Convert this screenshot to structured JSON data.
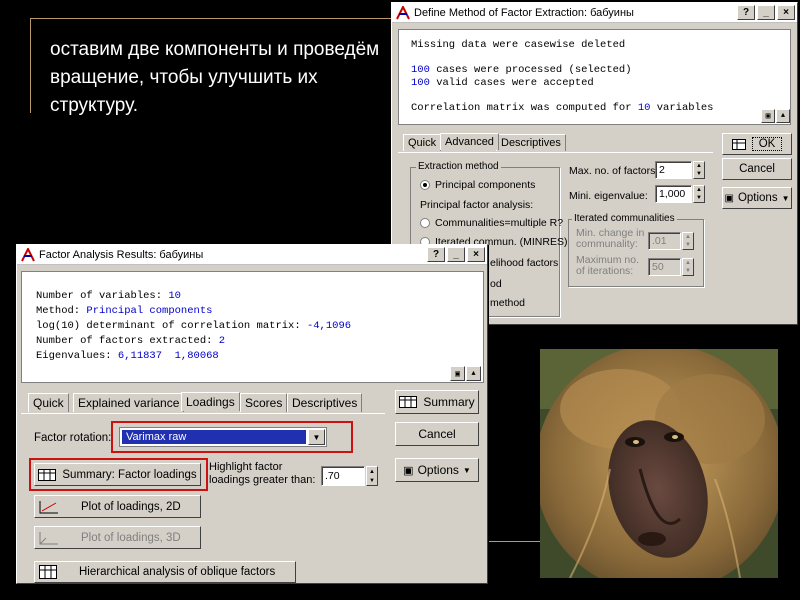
{
  "slide": {
    "text": "оставим две компоненты и проведём вращение, чтобы улучшить их структуру."
  },
  "define_window": {
    "title": "Define Method of Factor Extraction: бабуины",
    "output": {
      "missing": "Missing data were casewise deleted",
      "cases_processed_n": "100",
      "cases_processed_text": " cases were processed (selected)",
      "valid_cases_n": "100",
      "valid_cases_text": " valid cases were accepted",
      "corr_text": "Correlation matrix was computed for ",
      "corr_n": "10",
      "corr_unit": " variables"
    },
    "tabs": [
      "Quick",
      "Advanced",
      "Descriptives"
    ],
    "extraction_method_title": "Extraction method",
    "principal_components": "Principal components",
    "principal_factor_analysis": "Principal factor analysis:",
    "communalities_r": "Communalities=multiple R?",
    "iterated_communalities_option": "Iterated commun. (MINRES)",
    "likelihood_tail": "elihood factors",
    "method_tail_1": "od",
    "method_tail_2": "method",
    "max_factors_label": "Max. no. of factors:",
    "max_factors_value": "2",
    "min_eigen_label": "Mini. eigenvalue:",
    "min_eigen_value": "1,000",
    "iterated_group_title": "Iterated communalities",
    "min_change_label": "Min. change in communality:",
    "min_change_value": ".01",
    "max_iter_label": "Maximum no. of iterations:",
    "max_iter_value": "50",
    "ok_label": "OK",
    "cancel_label": "Cancel",
    "options_label": "Options"
  },
  "results_window": {
    "title": "Factor Analysis Results: бабуины",
    "output": {
      "num_vars_label": "Number of variables: ",
      "num_vars_value": "10",
      "method_label": "Method: ",
      "method_value": "Principal components",
      "log_label": "log(10) determinant of correlation matrix: ",
      "log_value": "-4,1096",
      "extracted_label": "Number of factors extracted: ",
      "extracted_value": "2",
      "eigen_label": "Eigenvalues: ",
      "eigen_value": "6,11837  1,80068"
    },
    "tabs": [
      "Quick",
      "Explained variance",
      "Loadings",
      "Scores",
      "Descriptives"
    ],
    "factor_rotation_label": "Factor rotation:",
    "factor_rotation_value": "Varimax raw",
    "summary_loadings_label": "Summary: Factor loadings",
    "highlight_label": "Highlight factor loadings greater than:",
    "highlight_value": ".70",
    "plot2d_label": "Plot of loadings, 2D",
    "plot3d_label": "Plot of loadings, 3D",
    "hier_label": "Hierarchical analysis of oblique factors",
    "summary_label": "Summary",
    "cancel_label": "Cancel",
    "options_label": "Options"
  },
  "icons": {
    "window_icon": "statistica-icon",
    "help": "?",
    "minimize": "_",
    "close": "×"
  },
  "colors": {
    "highlight_red": "#cc1111",
    "output_blue": "#0000cc",
    "accent_line": "#b89a68"
  }
}
